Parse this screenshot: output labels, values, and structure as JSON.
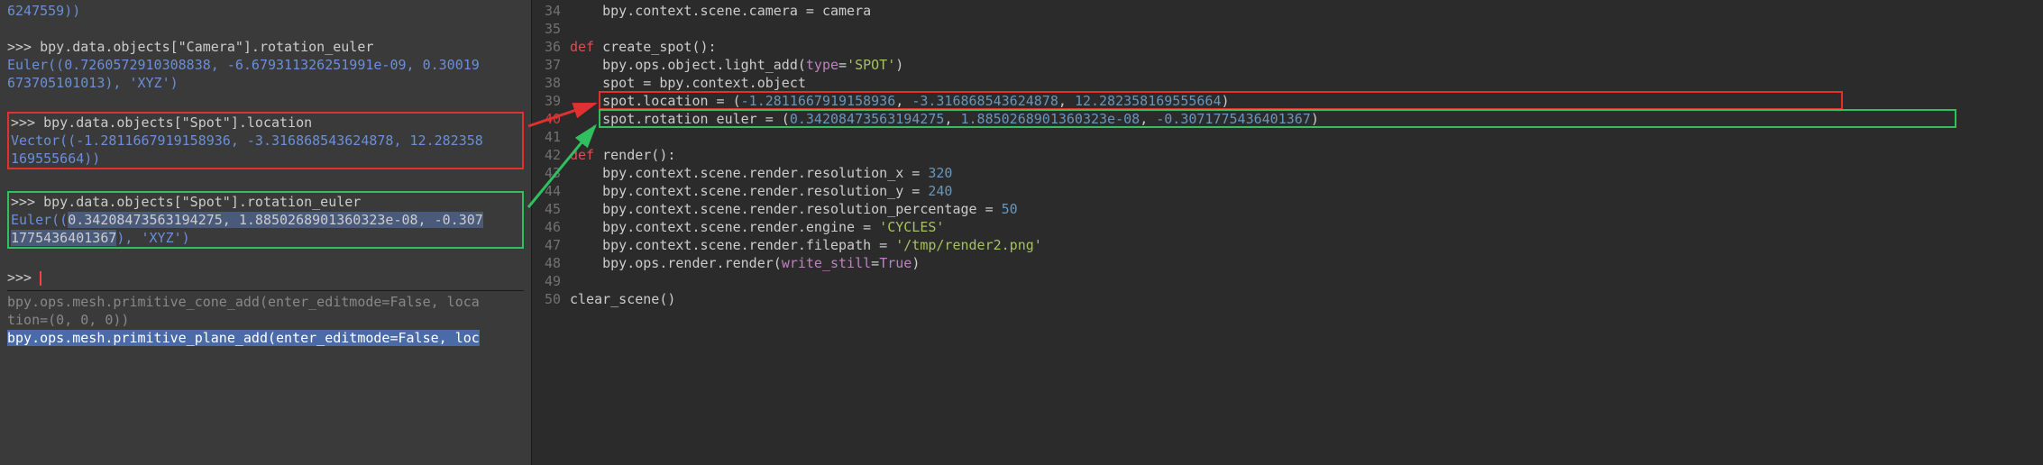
{
  "console": {
    "line0_partial": "6247559))",
    "cmd1_prompt": ">>> ",
    "cmd1": "bpy.data.objects[\"Camera\"].rotation_euler",
    "res1a": "Euler((0.7260572910308838, -6.679311326251991e-09, 0.30019",
    "res1b": "673705101013), 'XYZ')",
    "cmd2_prompt": ">>> ",
    "cmd2": "bpy.data.objects[\"Spot\"].location",
    "res2a": "Vector((-1.2811667919158936, -3.316868543624878, 12.282358",
    "res2b": "169555664))",
    "cmd3_prompt": ">>> ",
    "cmd3": "bpy.data.objects[\"Spot\"].rotation_euler",
    "res3a_pre": "Euler((",
    "res3a_sel": "0.34208473563194275, 1.8850268901360323e-08, -0.307",
    "res3b_sel": "1775436401367",
    "res3b_post": "), 'XYZ')",
    "cmd4_prompt": ">>> ",
    "hist1a": "bpy.ops.mesh.primitive_cone_add(enter_editmode=False, loca",
    "hist1b": "tion=(0, 0, 0))",
    "hist2": "bpy.ops.mesh.primitive_plane_add(enter_editmode=False, loc"
  },
  "editor": {
    "lines": {
      "l34_a": "    bpy.context.scene.camera = camera",
      "l36_kw": "def",
      "l36_name": " create_spot():",
      "l37_a": "    bpy.ops.object.light_add(",
      "l37_arg": "type",
      "l37_b": "=",
      "l37_str": "'SPOT'",
      "l37_c": ")",
      "l38_a": "    spot = bpy.context.object",
      "l39_a": "    spot.location = (",
      "l39_n1": "-1.2811667919158936",
      "l39_c1": ", ",
      "l39_n2": "-3.316868543624878",
      "l39_c2": ", ",
      "l39_n3": "12.282358169555664",
      "l39_c3": ")",
      "l40_a": "    spot.rotation_euler = (",
      "l40_n1": "0.34208473563194275",
      "l40_c1": ", ",
      "l40_n2": "1.8850268901360323e-08",
      "l40_c2": ", ",
      "l40_n3": "-0.3071775436401367",
      "l40_c3": ")",
      "l42_kw": "def",
      "l42_name": " render():",
      "l43": "    bpy.context.scene.render.resolution_x = ",
      "l43_n": "320",
      "l44": "    bpy.context.scene.render.resolution_y = ",
      "l44_n": "240",
      "l45": "    bpy.context.scene.render.resolution_percentage = ",
      "l45_n": "50",
      "l46a": "    bpy.context.scene.render.engine = ",
      "l46s": "'CYCLES'",
      "l47a": "    bpy.context.scene.render.filepath = ",
      "l47s": "'/tmp/render2.png'",
      "l48a": "    bpy.ops.render.render(",
      "l48arg": "write_still",
      "l48b": "=",
      "l48v": "True",
      "l48c": ")",
      "l50": "clear_scene()"
    },
    "line_numbers": [
      "34",
      "35",
      "36",
      "37",
      "38",
      "39",
      "40",
      "41",
      "42",
      "43",
      "44",
      "45",
      "46",
      "47",
      "48",
      "49",
      "50"
    ],
    "red_line_idx": 6
  }
}
